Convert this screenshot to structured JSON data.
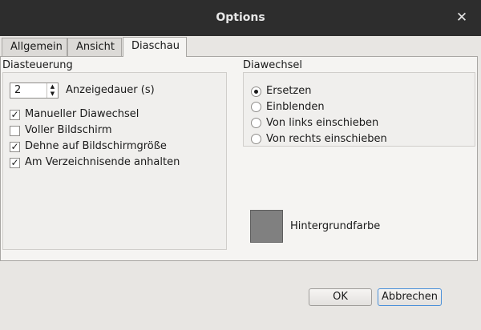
{
  "window": {
    "title": "Options"
  },
  "tabs": [
    {
      "label": "Allgemein"
    },
    {
      "label": "Ansicht"
    },
    {
      "label": "Diaschau"
    }
  ],
  "slideshow_control": {
    "title": "Diasteuerung",
    "duration": {
      "value": "2",
      "label": "Anzeigedauer (s)"
    },
    "checkboxes": [
      {
        "label": "Manueller Diawechsel",
        "checked": true
      },
      {
        "label": "Voller Bildschirm",
        "checked": false
      },
      {
        "label": "Dehne auf Bildschirmgröße",
        "checked": true
      },
      {
        "label": "Am Verzeichnisende anhalten",
        "checked": true
      }
    ]
  },
  "transition": {
    "title": "Diawechsel",
    "options": [
      {
        "label": "Ersetzen",
        "selected": true
      },
      {
        "label": "Einblenden",
        "selected": false
      },
      {
        "label": "Von links einschieben",
        "selected": false
      },
      {
        "label": "Von rechts einschieben",
        "selected": false
      }
    ]
  },
  "background": {
    "label": "Hintergrundfarbe",
    "color": "#808080"
  },
  "buttons": {
    "ok": "OK",
    "cancel": "Abbrechen"
  }
}
